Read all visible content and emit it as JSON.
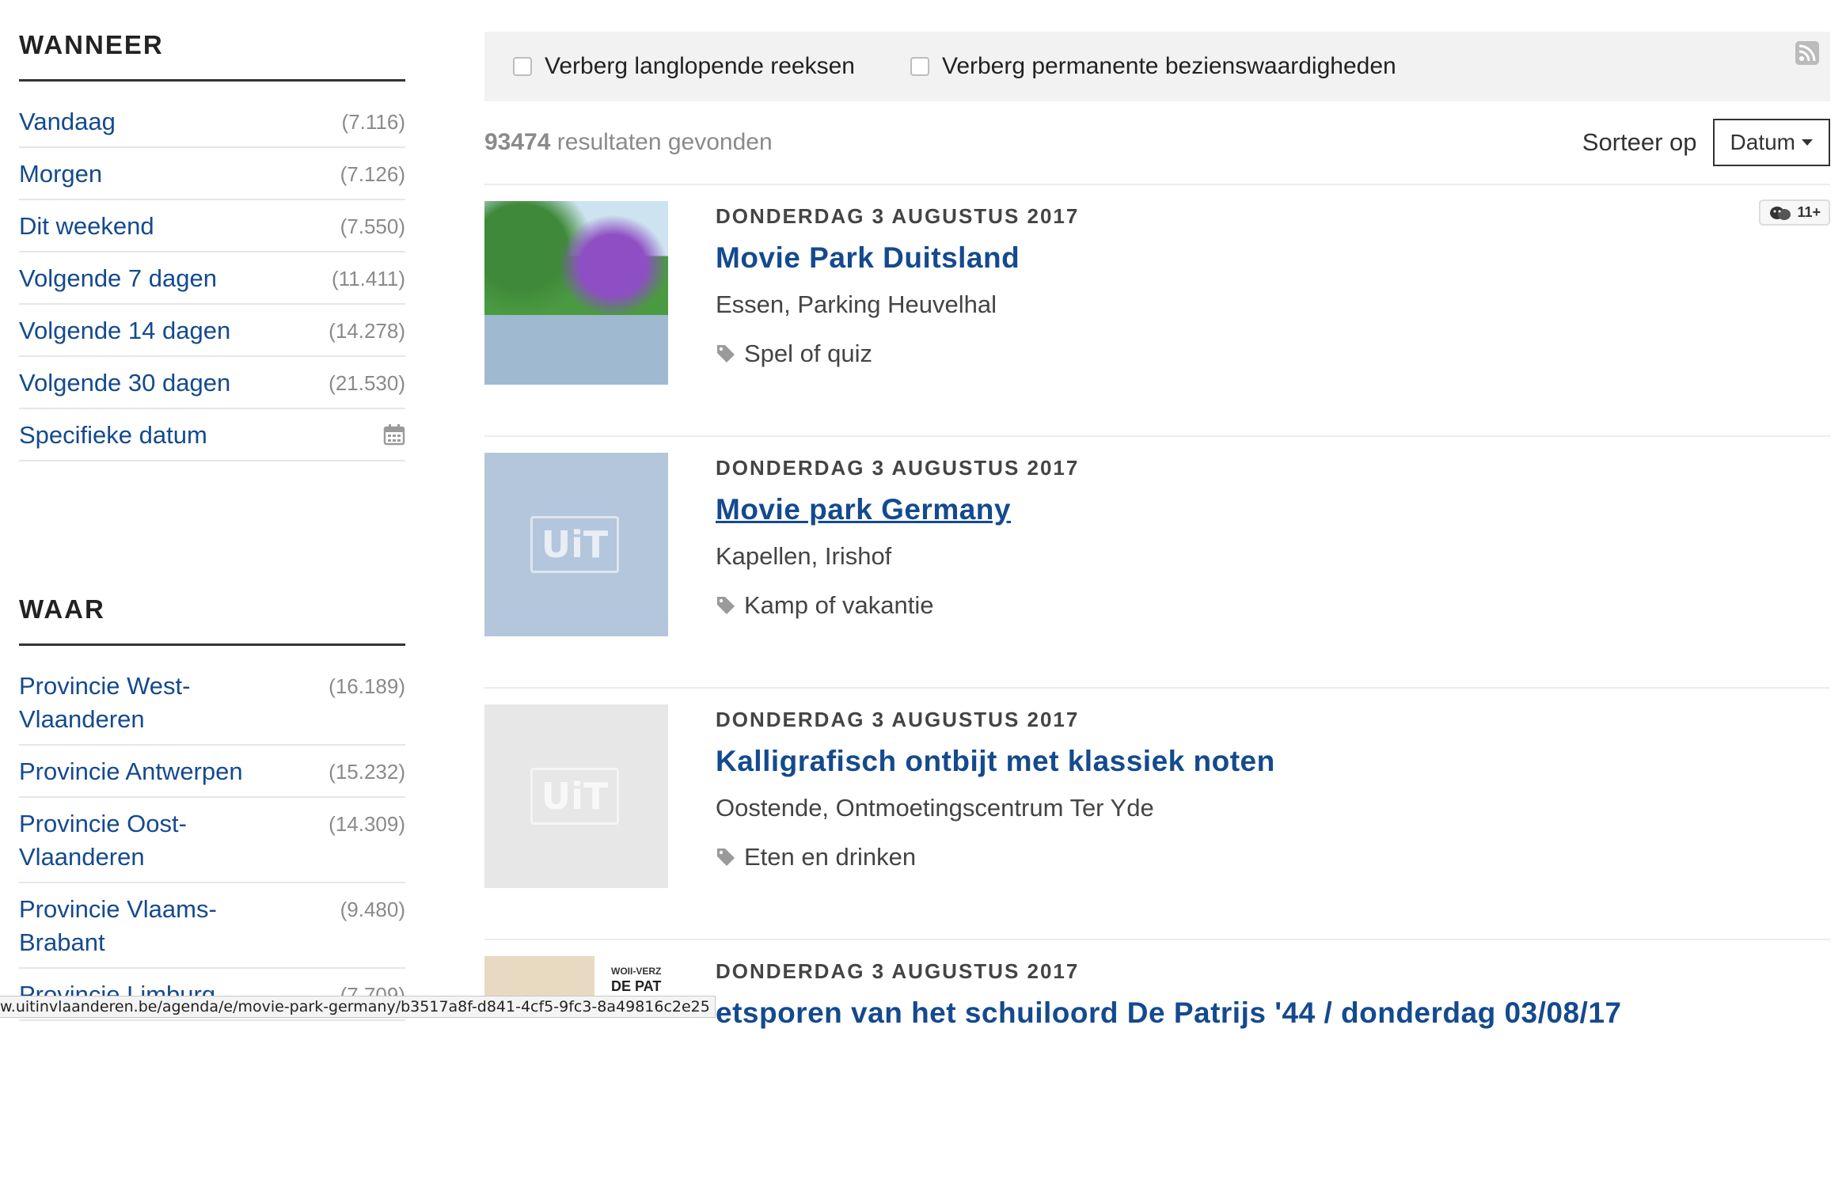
{
  "sidebar": {
    "when": {
      "title": "WANNEER",
      "items": [
        {
          "label": "Vandaag",
          "count": "(7.116)"
        },
        {
          "label": "Morgen",
          "count": "(7.126)"
        },
        {
          "label": "Dit weekend",
          "count": "(7.550)"
        },
        {
          "label": "Volgende 7 dagen",
          "count": "(11.411)"
        },
        {
          "label": "Volgende 14 dagen",
          "count": "(14.278)"
        },
        {
          "label": "Volgende 30 dagen",
          "count": "(21.530)"
        }
      ],
      "specific_date": "Specifieke datum",
      "specific_icon": "calendar-icon"
    },
    "where": {
      "title": "WAAR",
      "items": [
        {
          "label": "Provincie West-Vlaanderen",
          "count": "(16.189)"
        },
        {
          "label": "Provincie Antwerpen",
          "count": "(15.232)"
        },
        {
          "label": "Provincie Oost-Vlaanderen",
          "count": "(14.309)"
        },
        {
          "label": "Provincie Vlaams-Brabant",
          "count": "(9.480)"
        },
        {
          "label": "Provincie Limburg",
          "count": "(7.709)"
        }
      ]
    }
  },
  "filters": {
    "hide_long_running": "Verberg langlopende reeksen",
    "hide_permanent": "Verberg permanente bezienswaardigheden",
    "rss_icon": "rss-icon"
  },
  "results": {
    "count": "93474",
    "count_suffix": " resultaten gevonden",
    "sort_label": "Sorteer op",
    "sort_value": "Datum"
  },
  "events": [
    {
      "date": "DONDERDAG 3 AUGUSTUS 2017",
      "title": "Movie Park Duitsland",
      "location": "Essen, Parking Heuvelhal",
      "tag": "Spel of quiz",
      "age": "11+"
    },
    {
      "date": "DONDERDAG 3 AUGUSTUS 2017",
      "title": "Movie park Germany",
      "location": "Kapellen, Irishof",
      "tag": "Kamp of vakantie",
      "logo": "UiT"
    },
    {
      "date": "DONDERDAG 3 AUGUSTUS 2017",
      "title": "Kalligrafisch ontbijt met klassiek noten",
      "location": "Oostende, Ontmoetingscentrum Ter Yde",
      "tag": "Eten en drinken",
      "logo": "UiT"
    },
    {
      "date": "DONDERDAG 3 AUGUSTUS 2017",
      "title": "etsporen van het schuiloord De Patrijs '44 / donderdag 03/08/17",
      "poster_text_1": "WOII-VERZ",
      "poster_text_2": "DE PAT"
    }
  ],
  "statusbar": {
    "url": "w.uitinvlaanderen.be/agenda/e/movie-park-germany/b3517a8f-d841-4cf5-9fc3-8a49816c2e25"
  },
  "colors": {
    "link": "#144a8e",
    "muted": "#8a8a8a",
    "panel": "#f2f2f2"
  }
}
